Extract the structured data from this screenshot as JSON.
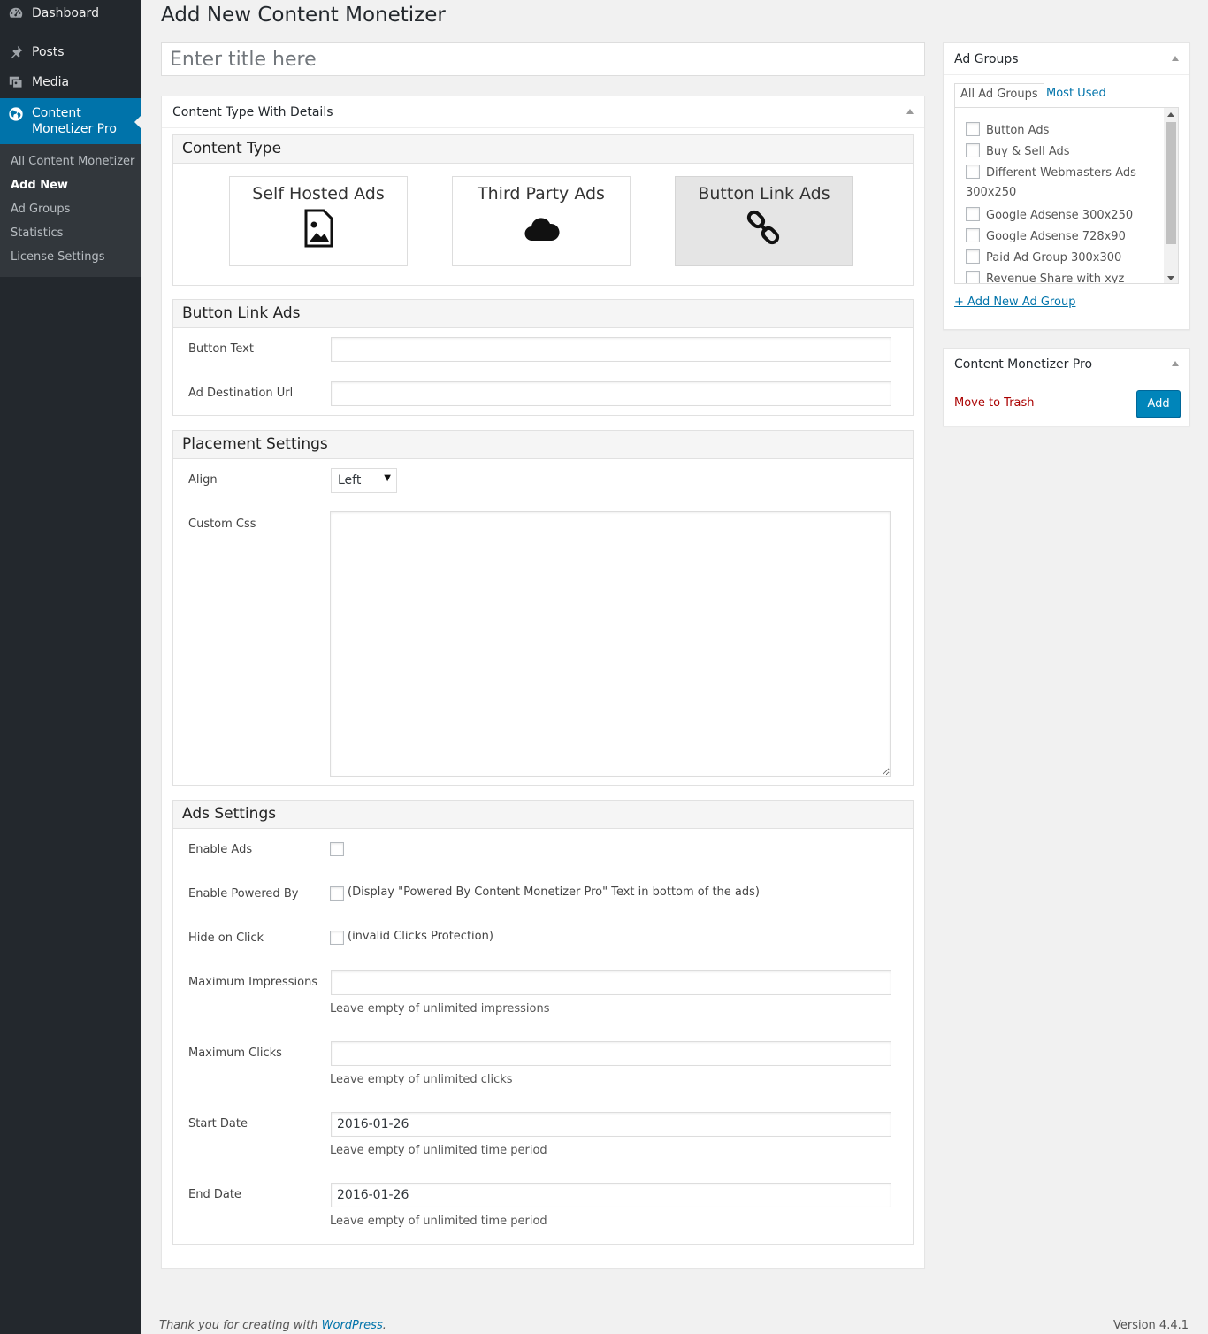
{
  "sidebar": {
    "menu": [
      {
        "label": "Dashboard",
        "icon": "dashboard-icon"
      },
      {
        "label": "Posts",
        "icon": "pin-icon"
      },
      {
        "label": "Media",
        "icon": "media-icon"
      },
      {
        "label": "Content Monetizer Pro",
        "icon": "globe-icon"
      }
    ],
    "submenu": [
      "All Content Monetizer",
      "Add New",
      "Ad Groups",
      "Statistics",
      "License Settings"
    ]
  },
  "page": {
    "title": "Add New Content Monetizer",
    "title_placeholder": "Enter title here"
  },
  "content_box": {
    "header": "Content Type With Details",
    "content_type": {
      "heading": "Content Type",
      "options": [
        "Self Hosted Ads",
        "Third Party Ads",
        "Button Link Ads"
      ],
      "selected": "Button Link Ads"
    },
    "button_link_ads": {
      "heading": "Button Link Ads",
      "button_text_label": "Button Text",
      "button_text_value": "",
      "destination_label": "Ad Destination Url",
      "destination_value": ""
    },
    "placement": {
      "heading": "Placement Settings",
      "align_label": "Align",
      "align_value": "Left",
      "custom_css_label": "Custom Css",
      "custom_css_value": ""
    },
    "ads_settings": {
      "heading": "Ads Settings",
      "enable_ads_label": "Enable Ads",
      "enable_powered_label": "Enable Powered By",
      "enable_powered_text": "(Display \"Powered By Content Monetizer Pro\" Text in bottom of the ads)",
      "hide_on_click_label": "Hide on Click",
      "hide_on_click_text": "(invalid Clicks Protection)",
      "max_impressions_label": "Maximum Impressions",
      "max_impressions_value": "",
      "max_impressions_hint": "Leave empty of unlimited impressions",
      "max_clicks_label": "Maximum Clicks",
      "max_clicks_value": "",
      "max_clicks_hint": "Leave empty of unlimited clicks",
      "start_date_label": "Start Date",
      "start_date_value": "2016-01-26",
      "start_date_hint": "Leave empty of unlimited time period",
      "end_date_label": "End Date",
      "end_date_value": "2016-01-26",
      "end_date_hint": "Leave empty of unlimited time period"
    }
  },
  "ad_groups": {
    "header": "Ad Groups",
    "tab_all": "All Ad Groups",
    "tab_most_used": "Most Used",
    "items": [
      "Button Ads",
      "Buy & Sell Ads",
      "Different Webmasters Ads",
      "300x250",
      "Google Adsense 300x250",
      "Google Adsense 728x90",
      "Paid Ad Group 300x300",
      "Revenue Share with xyz"
    ],
    "add_new_link": "+ Add New Ad Group"
  },
  "publish_box": {
    "header": "Content Monetizer Pro",
    "trash_label": "Move to Trash",
    "add_label": "Add"
  },
  "footer": {
    "thanks_prefix": "Thank you for creating with",
    "thanks_link": "WordPress",
    "thanks_suffix": ".",
    "version": "Version 4.4.1"
  },
  "colors": {
    "sidebar_bg": "#23282d",
    "active_menu": "#0073aa",
    "link": "#0073aa",
    "trash": "#a00",
    "primary_button": "#0085ba"
  }
}
